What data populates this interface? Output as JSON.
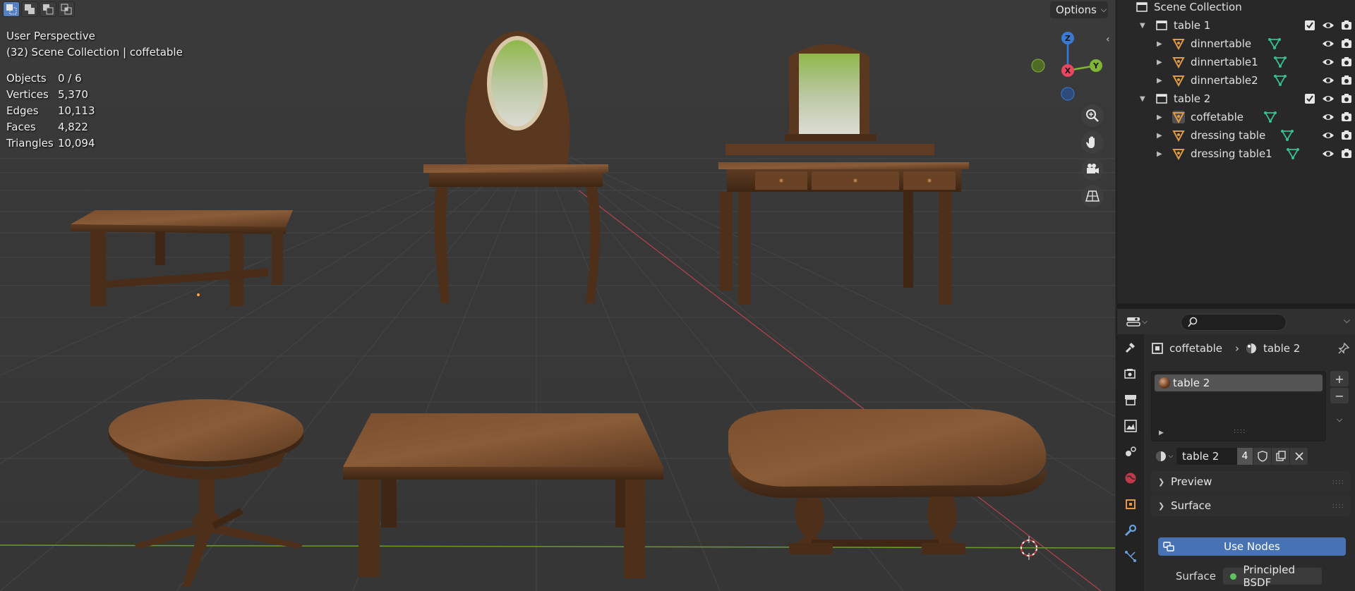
{
  "viewport": {
    "mode_buttons": [
      "select-new-icon",
      "select-extend-icon",
      "select-subtract-icon",
      "select-intersect-icon"
    ],
    "perspective": "User Perspective",
    "collection_info": "(32) Scene Collection | coffetable",
    "stats": [
      {
        "label": "Objects",
        "value": "0 / 6"
      },
      {
        "label": "Vertices",
        "value": "5,370"
      },
      {
        "label": "Edges",
        "value": "10,113"
      },
      {
        "label": "Faces",
        "value": "4,822"
      },
      {
        "label": "Triangles",
        "value": "10,094"
      }
    ],
    "options_label": "Options",
    "gizmo": {
      "x": "X",
      "y": "Y",
      "z": "Z"
    }
  },
  "outliner": {
    "root": "Scene Collection",
    "collections": [
      {
        "name": "table 1",
        "objects": [
          "dinnertable",
          "dinnertable1",
          "dinnertable2"
        ]
      },
      {
        "name": "table 2",
        "objects": [
          "coffetable",
          "dressing table",
          "dressing table1"
        ]
      }
    ]
  },
  "properties": {
    "search_placeholder": "",
    "breadcrumb": {
      "object": "coffetable",
      "material": "table 2"
    },
    "slot": "table 2",
    "material_name": "table 2",
    "material_users": "4",
    "panels": {
      "preview": "Preview",
      "surface": "Surface"
    },
    "use_nodes": "Use Nodes",
    "surface_label": "Surface",
    "surface_value": "Principled BSDF"
  },
  "colors": {
    "viewport_bg": "#393939",
    "wood": "#6b4327",
    "accent_blue": "#4772b3",
    "axis_x": "#e8475f",
    "axis_y": "#7fb636",
    "axis_z": "#3a7ad6",
    "mesh_data_icon": "#37c08f",
    "object_icon": "#e39a48"
  }
}
